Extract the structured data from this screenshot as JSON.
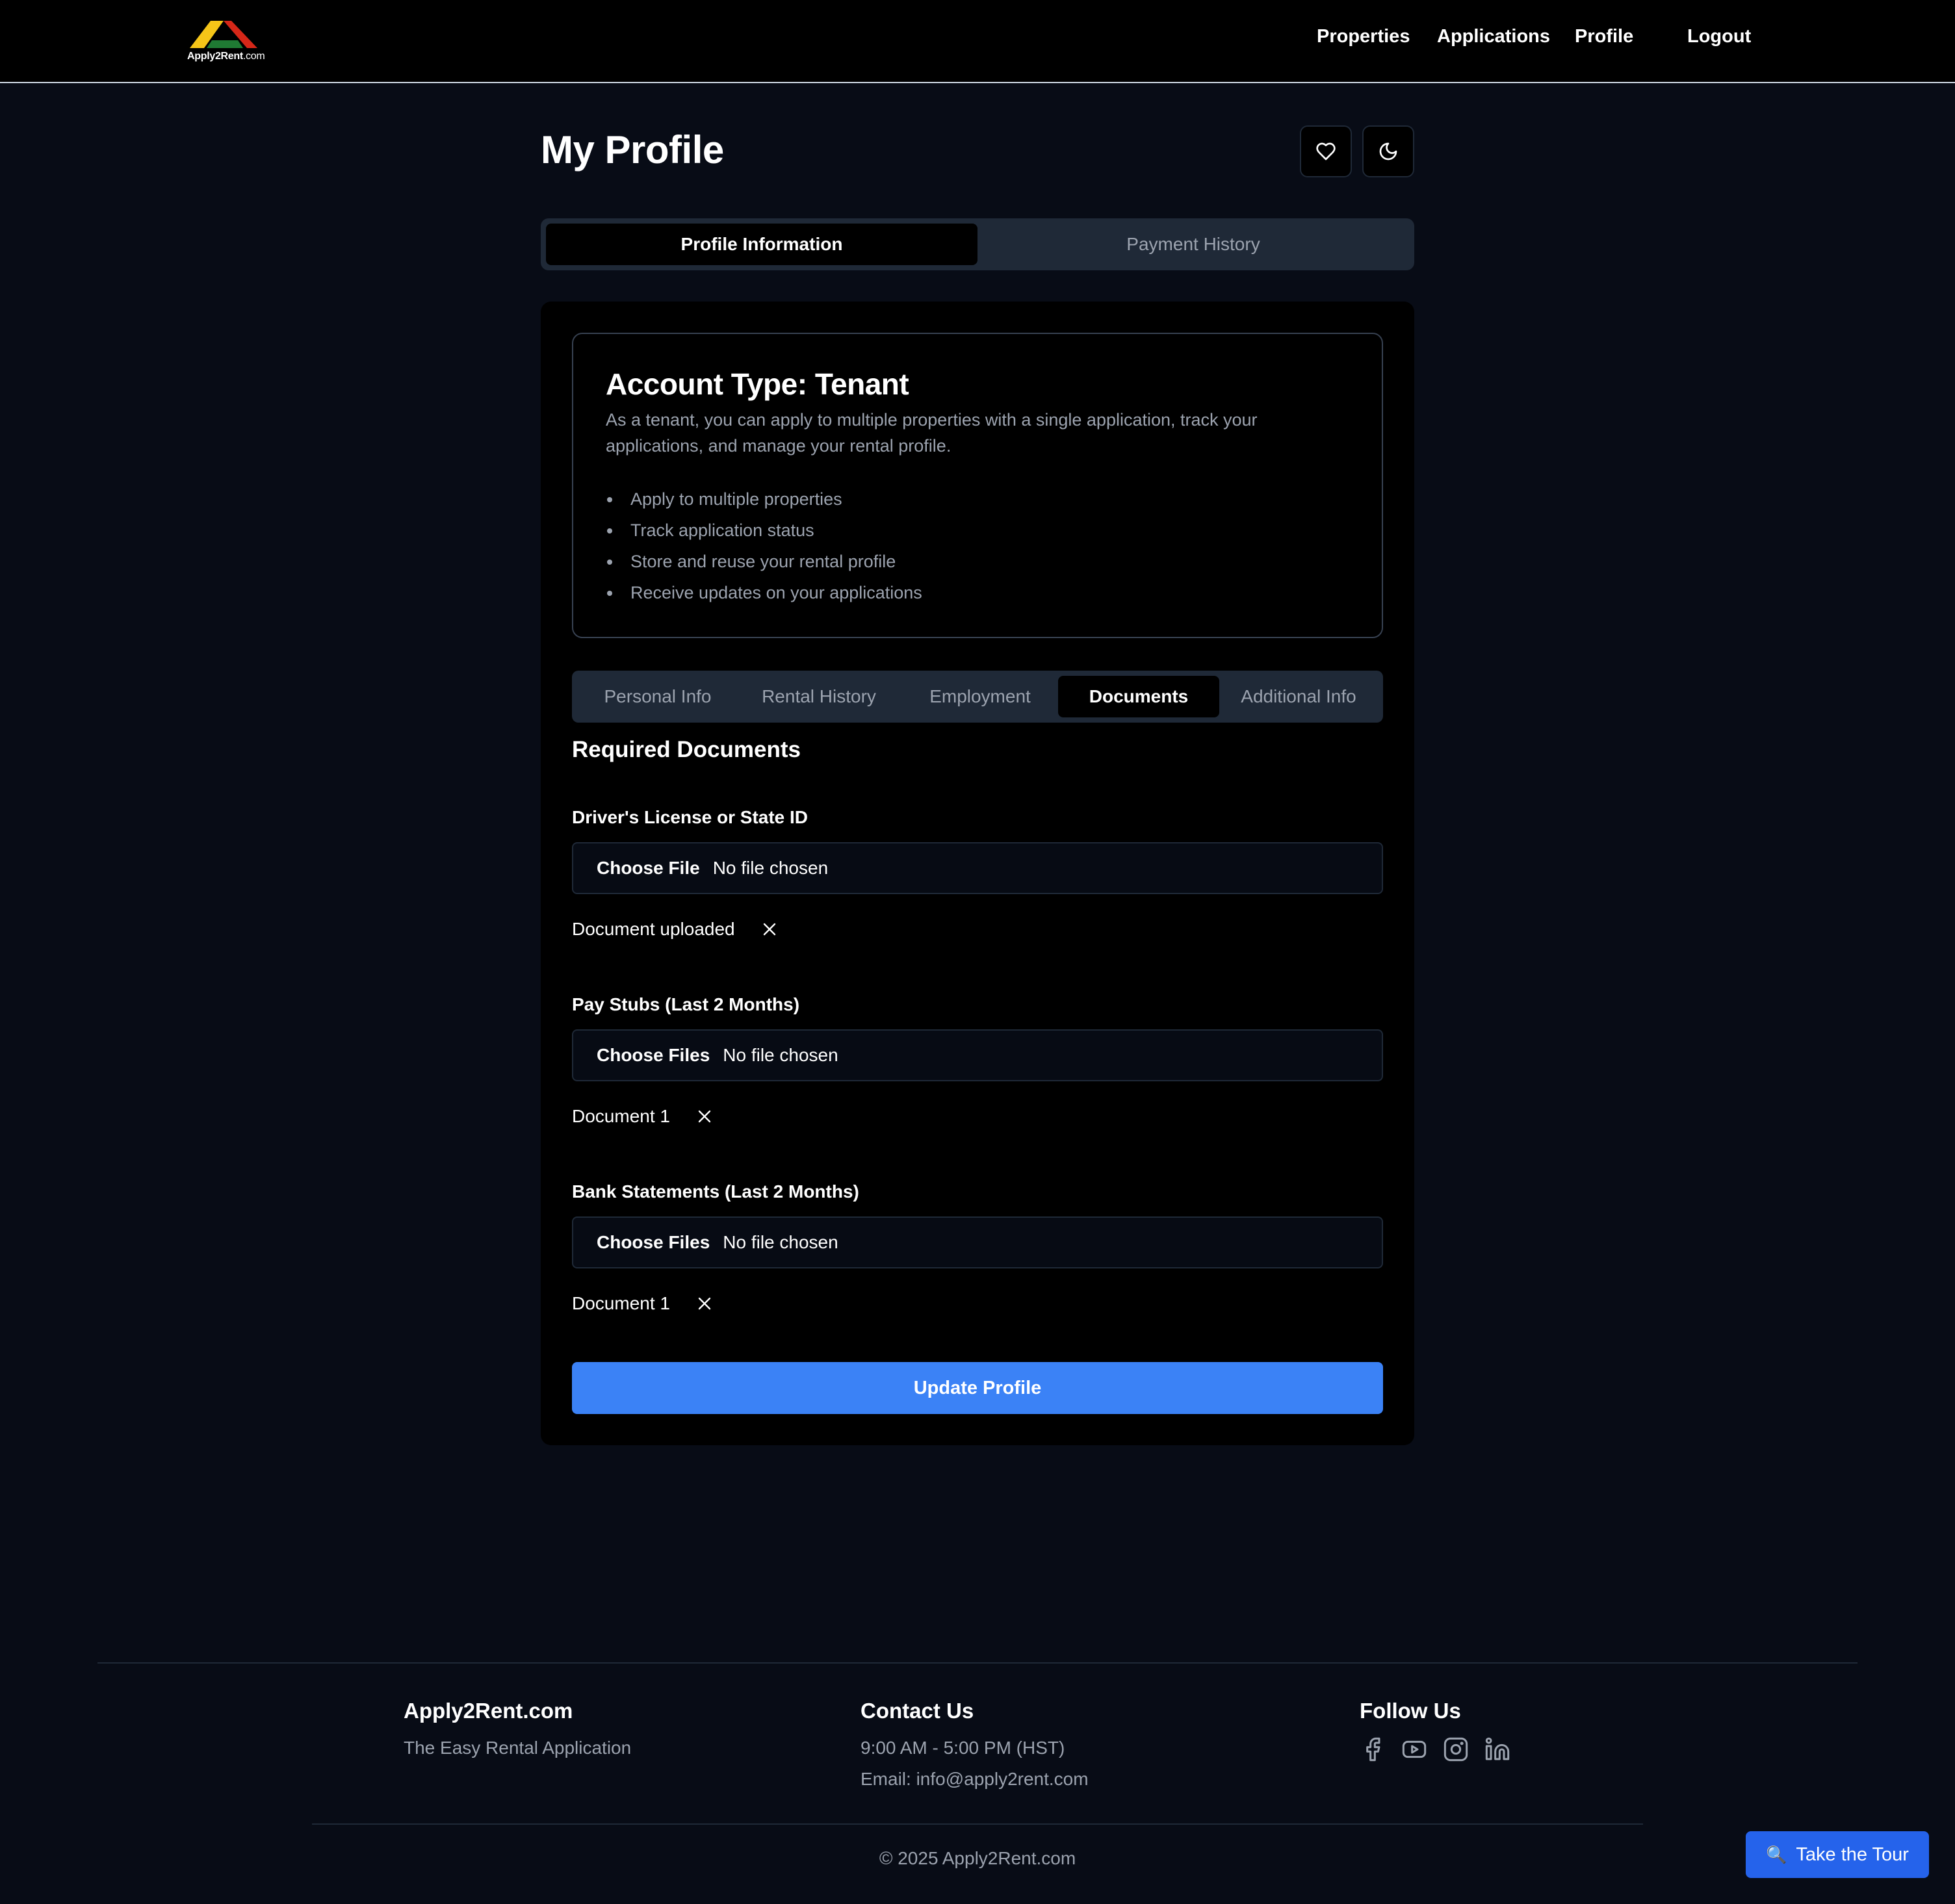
{
  "nav": {
    "logo_main": "Apply2Rent",
    "logo_suffix": ".com",
    "links": [
      "Properties",
      "Applications",
      "Profile",
      "Logout"
    ]
  },
  "header": {
    "title": "My Profile",
    "favorite_icon": "heart-icon",
    "theme_icon": "moon-icon"
  },
  "main_tabs": {
    "active": "Profile Information",
    "inactive": "Payment History"
  },
  "account": {
    "title": "Account Type: Tenant",
    "description": "As a tenant, you can apply to multiple properties with a single application, track your applications, and manage your rental profile.",
    "features": [
      "Apply to multiple properties",
      "Track application status",
      "Store and reuse your rental profile",
      "Receive updates on your applications"
    ]
  },
  "sub_tabs": [
    "Personal Info",
    "Rental History",
    "Employment",
    "Documents",
    "Additional Info"
  ],
  "sub_tab_active": "Documents",
  "documents": {
    "section_title": "Required Documents",
    "fields": [
      {
        "label": "Driver's License or State ID",
        "button": "Choose File",
        "status": "No file chosen",
        "uploaded": "Document uploaded"
      },
      {
        "label": "Pay Stubs (Last 2 Months)",
        "button": "Choose Files",
        "status": "No file chosen",
        "uploaded": "Document 1"
      },
      {
        "label": "Bank Statements (Last 2 Months)",
        "button": "Choose Files",
        "status": "No file chosen",
        "uploaded": "Document 1"
      }
    ],
    "submit": "Update Profile"
  },
  "footer": {
    "brand": "Apply2Rent.com",
    "tagline": "The Easy Rental Application",
    "contact_heading": "Contact Us",
    "hours": "9:00 AM - 5:00 PM (HST)",
    "email": "Email: info@apply2rent.com",
    "follow_heading": "Follow Us",
    "social_icons": [
      "facebook-icon",
      "youtube-icon",
      "instagram-icon",
      "linkedin-icon"
    ],
    "copyright": "© 2025 Apply2Rent.com"
  },
  "tour_button": "Take the Tour",
  "colors": {
    "accent": "#3b82f6",
    "tour": "#2563eb",
    "background": "#080c16"
  }
}
